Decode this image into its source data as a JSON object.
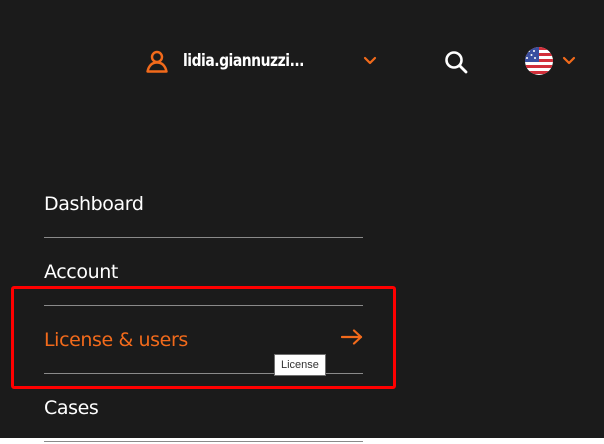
{
  "header": {
    "user_name": "lidia.giannuzzi...",
    "user_icon": "user-icon",
    "search_icon": "search-icon",
    "language_flag": "us-flag-icon"
  },
  "menu": {
    "items": [
      {
        "label": "Dashboard"
      },
      {
        "label": "Account"
      },
      {
        "label": "License & users",
        "active": true
      },
      {
        "label": "Cases"
      }
    ]
  },
  "tooltip": {
    "text": "License"
  },
  "colors": {
    "background": "#1b1b1b",
    "accent": "#f26a1b",
    "text": "#ffffff",
    "divider": "#8a8a8a",
    "highlight": "#ff0000"
  }
}
